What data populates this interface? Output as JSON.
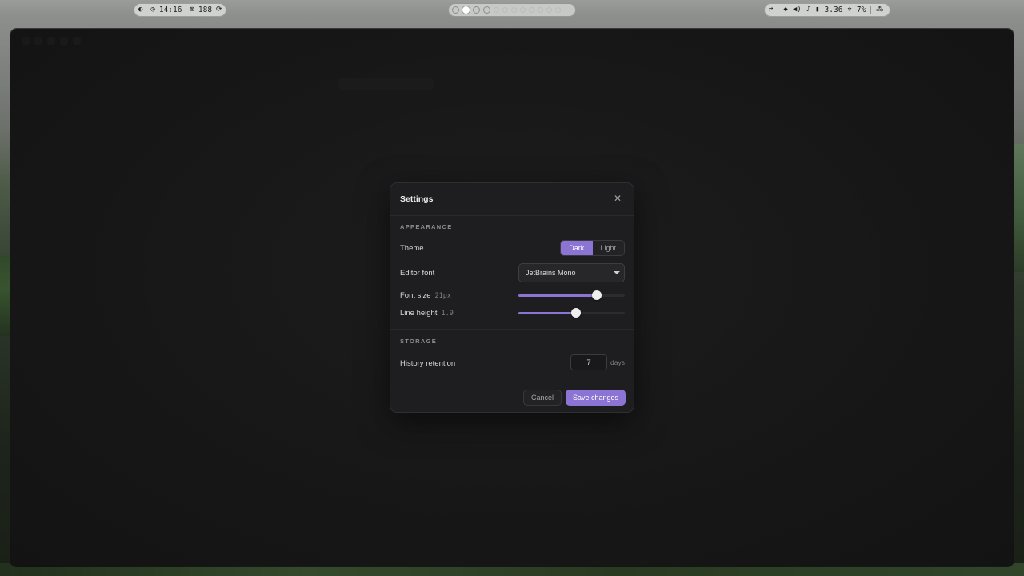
{
  "topbar": {
    "left": {
      "clock": "14:16",
      "count": "188"
    },
    "workspaces": {
      "active_index": 1
    },
    "right": {
      "value": "3.36",
      "percent": "7%"
    }
  },
  "dialog": {
    "title": "Settings",
    "close_icon": "close-icon",
    "appearance": {
      "section": "APPEARANCE",
      "theme_label": "Theme",
      "theme_options": [
        "Dark",
        "Light"
      ],
      "theme_selected": "Dark",
      "font_label": "Editor font",
      "font_value": "JetBrains Mono",
      "font_size_label": "Font size",
      "font_size_value": "21px",
      "font_size_fraction": 0.74,
      "line_height_label": "Line height",
      "line_height_value": "1.9",
      "line_height_fraction": 0.54
    },
    "storage": {
      "section": "STORAGE",
      "history_label": "History retention",
      "history_value": "7",
      "history_unit": "days"
    },
    "footer": {
      "cancel": "Cancel",
      "save": "Save changes"
    }
  },
  "colors": {
    "accent": "#8b74d4",
    "panel": "#1e1e20",
    "backdrop": "#151515"
  }
}
